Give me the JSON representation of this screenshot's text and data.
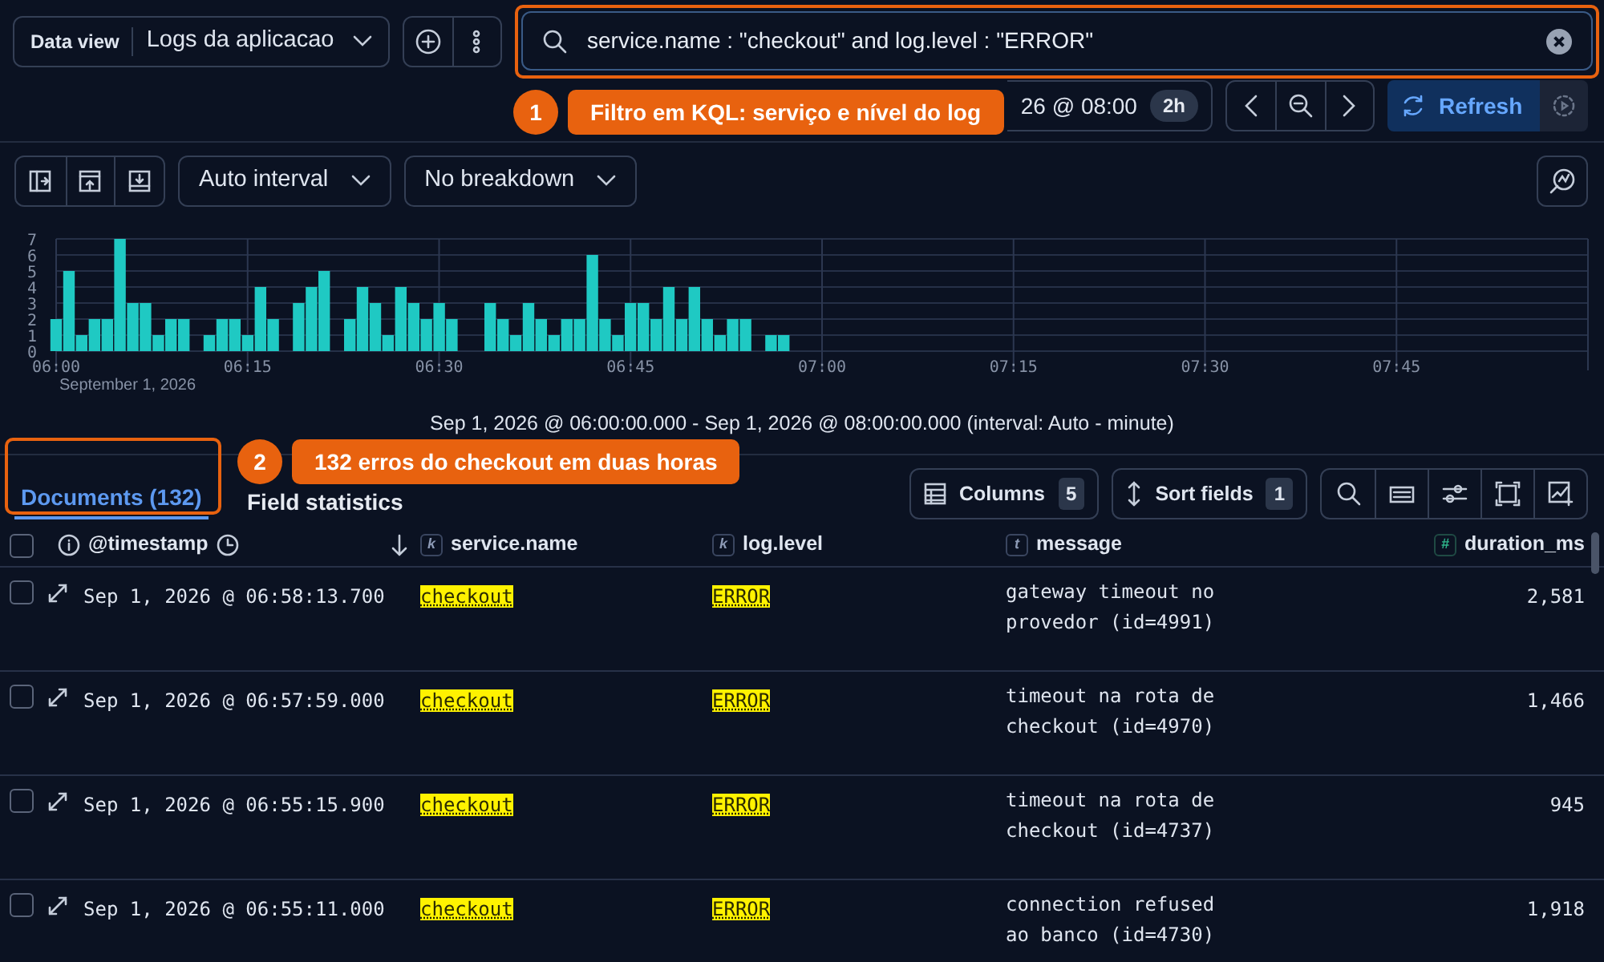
{
  "toolbar": {
    "data_view_label": "Data view",
    "data_view": "Logs da aplicacao",
    "query": "service.name : \"checkout\" and log.level : \"ERROR\""
  },
  "time_picker": {
    "end_fragment": "26 @ 08:00",
    "duration": "2h",
    "refresh_label": "Refresh"
  },
  "chart_toolbar": {
    "interval": "Auto interval",
    "breakdown": "No breakdown"
  },
  "histogram": {
    "date_label": "September 1, 2026",
    "range_text": "Sep 1, 2026 @ 06:00:00.000 - Sep 1, 2026 @ 08:00:00.000 (interval: Auto - minute)",
    "chart_data": {
      "type": "bar",
      "x": [
        360,
        361,
        362,
        363,
        364,
        365,
        366,
        367,
        368,
        369,
        370,
        371,
        372,
        373,
        374,
        375,
        376,
        377,
        378,
        379,
        380,
        381,
        382,
        383,
        384,
        385,
        386,
        387,
        388,
        389,
        390,
        391,
        392,
        393,
        394,
        395,
        396,
        397,
        398,
        399,
        400,
        401,
        402,
        403,
        404,
        405,
        406,
        407,
        408,
        409,
        410,
        411,
        412,
        413,
        414,
        415,
        416,
        417
      ],
      "grid": true,
      "xlim": [
        360,
        480
      ],
      "xticks": [
        {
          "value": 360,
          "label": "06:00"
        },
        {
          "value": 375,
          "label": "06:15"
        },
        {
          "value": 390,
          "label": "06:30"
        },
        {
          "value": 405,
          "label": "06:45"
        },
        {
          "value": 420,
          "label": "07:00"
        },
        {
          "value": 435,
          "label": "07:15"
        },
        {
          "value": 450,
          "label": "07:30"
        },
        {
          "value": 465,
          "label": "07:45"
        }
      ],
      "values": [
        2,
        5,
        1,
        2,
        2,
        7,
        3,
        3,
        1,
        2,
        2,
        0,
        1,
        2,
        2,
        1,
        4,
        2,
        0,
        3,
        4,
        5,
        0,
        2,
        4,
        3,
        1,
        4,
        3,
        2,
        3,
        2,
        0,
        0,
        3,
        2,
        1,
        3,
        2,
        1,
        2,
        2,
        6,
        2,
        1,
        3,
        3,
        2,
        4,
        2,
        4,
        2,
        1,
        2,
        2,
        0,
        1,
        1
      ],
      "ylim": [
        0,
        7
      ],
      "yticks": [
        0,
        1,
        2,
        3,
        4,
        5,
        6,
        7
      ]
    }
  },
  "tabs": [
    {
      "label": "Documents (132)",
      "selected": true
    },
    {
      "label": "Field statistics",
      "selected": false
    }
  ],
  "grid_toolbar": {
    "columns_label": "Columns",
    "columns_count": "5",
    "sort_label": "Sort fields",
    "sort_count": "1"
  },
  "table": {
    "select_all_checked": false,
    "columns": [
      {
        "label": "@timestamp",
        "kind": "time"
      },
      {
        "label": "service.name",
        "kind": "keyword",
        "badge": "k"
      },
      {
        "label": "log.level",
        "kind": "keyword",
        "badge": "k"
      },
      {
        "label": "message",
        "kind": "text",
        "badge": "t"
      },
      {
        "label": "duration_ms",
        "kind": "number",
        "badge": "#"
      }
    ],
    "rows": [
      {
        "checked": false,
        "timestamp": "Sep 1, 2026 @ 06:58:13.700",
        "service": "checkout",
        "level": "ERROR",
        "highlighted": true,
        "message": "gateway timeout no provedor (id=4991)",
        "duration": "2,581"
      },
      {
        "checked": false,
        "timestamp": "Sep 1, 2026 @ 06:57:59.000",
        "service": "checkout",
        "level": "ERROR",
        "highlighted": true,
        "message": "timeout na rota de checkout (id=4970)",
        "duration": "1,466"
      },
      {
        "checked": false,
        "timestamp": "Sep 1, 2026 @ 06:55:15.900",
        "service": "checkout",
        "level": "ERROR",
        "highlighted": true,
        "message": "timeout na rota de checkout (id=4737)",
        "duration": "945"
      },
      {
        "checked": false,
        "timestamp": "Sep 1, 2026 @ 06:55:11.000",
        "service": "checkout",
        "level": "ERROR",
        "highlighted": true,
        "message": "connection refused ao banco (id=4730)",
        "duration": "1,918"
      }
    ]
  },
  "annotations": [
    {
      "number": "1",
      "text": "Filtro em KQL: serviço e nível do log"
    },
    {
      "number": "2",
      "text": "132 erros do checkout em duas horas"
    }
  ]
}
